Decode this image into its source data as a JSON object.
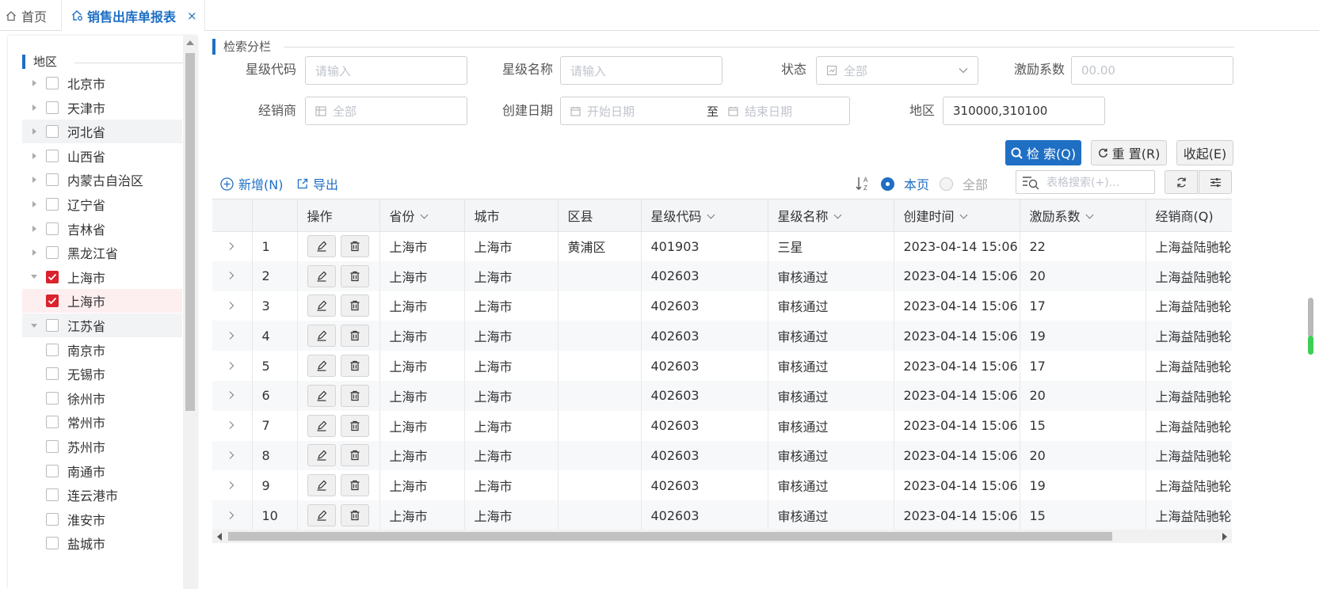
{
  "tabs": {
    "home": "首页",
    "active": "销售出库单报表",
    "close": "×"
  },
  "tree": {
    "title": "地区",
    "nodes": [
      {
        "label": "北京市",
        "expander": "right",
        "checked": false,
        "child": false,
        "state": ""
      },
      {
        "label": "天津市",
        "expander": "right",
        "checked": false,
        "child": false,
        "state": ""
      },
      {
        "label": "河北省",
        "expander": "right",
        "checked": false,
        "child": false,
        "state": "hover"
      },
      {
        "label": "山西省",
        "expander": "right",
        "checked": false,
        "child": false,
        "state": ""
      },
      {
        "label": "内蒙古自治区",
        "expander": "right",
        "checked": false,
        "child": false,
        "state": ""
      },
      {
        "label": "辽宁省",
        "expander": "right",
        "checked": false,
        "child": false,
        "state": ""
      },
      {
        "label": "吉林省",
        "expander": "right",
        "checked": false,
        "child": false,
        "state": ""
      },
      {
        "label": "黑龙江省",
        "expander": "right",
        "checked": false,
        "child": false,
        "state": ""
      },
      {
        "label": "上海市",
        "expander": "down",
        "checked": true,
        "child": false,
        "state": ""
      },
      {
        "label": "上海市",
        "expander": "none",
        "checked": true,
        "child": true,
        "state": "selected"
      },
      {
        "label": "江苏省",
        "expander": "down",
        "checked": false,
        "child": false,
        "state": "hover"
      },
      {
        "label": "南京市",
        "expander": "none",
        "checked": false,
        "child": true,
        "state": ""
      },
      {
        "label": "无锡市",
        "expander": "none",
        "checked": false,
        "child": true,
        "state": ""
      },
      {
        "label": "徐州市",
        "expander": "none",
        "checked": false,
        "child": true,
        "state": ""
      },
      {
        "label": "常州市",
        "expander": "none",
        "checked": false,
        "child": true,
        "state": ""
      },
      {
        "label": "苏州市",
        "expander": "none",
        "checked": false,
        "child": true,
        "state": ""
      },
      {
        "label": "南通市",
        "expander": "none",
        "checked": false,
        "child": true,
        "state": ""
      },
      {
        "label": "连云港市",
        "expander": "none",
        "checked": false,
        "child": true,
        "state": ""
      },
      {
        "label": "淮安市",
        "expander": "none",
        "checked": false,
        "child": true,
        "state": ""
      },
      {
        "label": "盐城市",
        "expander": "none",
        "checked": false,
        "child": true,
        "state": ""
      }
    ]
  },
  "search": {
    "section_title": "检索分栏",
    "star_code_label": "星级代码",
    "star_code_placeholder": "请输入",
    "star_name_label": "星级名称",
    "star_name_placeholder": "请输入",
    "status_label": "状态",
    "status_value": "全部",
    "incentive_label": "激励系数",
    "incentive_placeholder": "00.00",
    "dealer_label": "经销商",
    "dealer_value": "全部",
    "date_label": "创建日期",
    "date_start": "开始日期",
    "date_sep": "至",
    "date_end": "结束日期",
    "region_label": "地区",
    "region_value": "310000,310100",
    "search_btn": "检 索(Q)",
    "reset_btn": "重 置(R)",
    "collapse_btn": "收起(E)"
  },
  "toolbar": {
    "add": "新增(N)",
    "export": "导出",
    "this_page": "本页",
    "all": "全部",
    "table_search_placeholder": "表格搜索(+)..."
  },
  "table": {
    "columns": [
      "",
      "",
      "操作",
      "省份",
      "城市",
      "区县",
      "星级代码",
      "星级名称",
      "创建时间",
      "激励系数",
      "经销商(Q)"
    ],
    "sortable": [
      false,
      false,
      false,
      true,
      false,
      false,
      true,
      true,
      true,
      true,
      false
    ],
    "rows": [
      {
        "no": "1",
        "province": "上海市",
        "city": "上海市",
        "district": "黄浦区",
        "code": "401903",
        "name": "三星",
        "time": "2023-04-14 15:06",
        "factor": "22",
        "dealer": "上海益陆驰轮胎"
      },
      {
        "no": "2",
        "province": "上海市",
        "city": "上海市",
        "district": "",
        "code": "402603",
        "name": "审核通过",
        "time": "2023-04-14 15:06",
        "factor": "20",
        "dealer": "上海益陆驰轮胎"
      },
      {
        "no": "3",
        "province": "上海市",
        "city": "上海市",
        "district": "",
        "code": "402603",
        "name": "审核通过",
        "time": "2023-04-14 15:06",
        "factor": "17",
        "dealer": "上海益陆驰轮胎"
      },
      {
        "no": "4",
        "province": "上海市",
        "city": "上海市",
        "district": "",
        "code": "402603",
        "name": "审核通过",
        "time": "2023-04-14 15:06",
        "factor": "19",
        "dealer": "上海益陆驰轮胎"
      },
      {
        "no": "5",
        "province": "上海市",
        "city": "上海市",
        "district": "",
        "code": "402603",
        "name": "审核通过",
        "time": "2023-04-14 15:06",
        "factor": "17",
        "dealer": "上海益陆驰轮胎"
      },
      {
        "no": "6",
        "province": "上海市",
        "city": "上海市",
        "district": "",
        "code": "402603",
        "name": "审核通过",
        "time": "2023-04-14 15:06",
        "factor": "20",
        "dealer": "上海益陆驰轮胎"
      },
      {
        "no": "7",
        "province": "上海市",
        "city": "上海市",
        "district": "",
        "code": "402603",
        "name": "审核通过",
        "time": "2023-04-14 15:06",
        "factor": "15",
        "dealer": "上海益陆驰轮胎"
      },
      {
        "no": "8",
        "province": "上海市",
        "city": "上海市",
        "district": "",
        "code": "402603",
        "name": "审核通过",
        "time": "2023-04-14 15:06",
        "factor": "20",
        "dealer": "上海益陆驰轮胎"
      },
      {
        "no": "9",
        "province": "上海市",
        "city": "上海市",
        "district": "",
        "code": "402603",
        "name": "审核通过",
        "time": "2023-04-14 15:06",
        "factor": "19",
        "dealer": "上海益陆驰轮胎"
      },
      {
        "no": "10",
        "province": "上海市",
        "city": "上海市",
        "district": "",
        "code": "402603",
        "name": "审核通过",
        "time": "2023-04-14 15:06",
        "factor": "15",
        "dealer": "上海益陆驰轮胎"
      }
    ]
  },
  "colors": {
    "primary": "#1f6fc4",
    "checkbox_checked": "#d9232d",
    "selected_row": "#fdeef0"
  }
}
